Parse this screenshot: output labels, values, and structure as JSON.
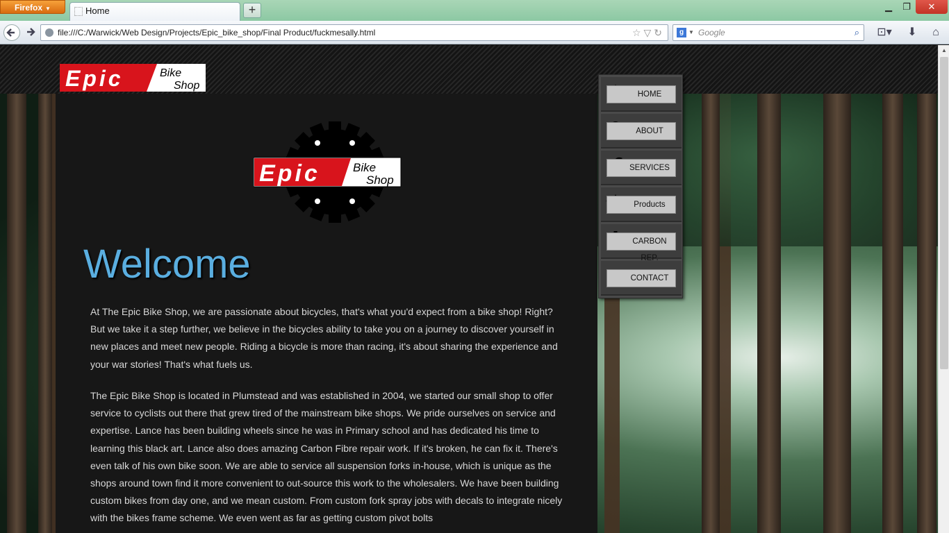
{
  "browser": {
    "app_button": "Firefox",
    "tab_title": "Home",
    "new_tab": "+",
    "url": "file:///C:/Warwick/Web Design/Projects/Epic_bike_shop/Final Product/fuckmesally.html",
    "search_placeholder": "Google"
  },
  "page": {
    "logo_text": "Epic",
    "logo_sub1": "Bike",
    "logo_sub2": "Shop",
    "welcome": "Welcome",
    "paragraphs": [
      "At The Epic Bike Shop, we are passionate about bicycles, that's what you'd expect from a bike shop! Right? But we take it a step further, we believe in the bicycles ability to take you on a journey to discover yourself in new places and meet new people. Riding a bicycle is more than racing, it's about sharing the experience and your war stories! That's what fuels us.",
      "The Epic Bike Shop is located in Plumstead and was established in 2004, we started our small shop to offer service to cyclists out there that grew tired of the mainstream bike shops. We pride ourselves on service and expertise. Lance has been building wheels since he was in Primary school and has dedicated his time to learning this black art. Lance also does amazing Carbon Fibre repair work. If it's broken, he can fix it. There's even talk of his own bike soon. We are able to service all suspension forks in-house, which is unique as the shops around town find it more convenient to out-source this work to the wholesalers. We have been building custom bikes from day one, and we mean custom. From custom fork spray jobs with decals to integrate nicely with the bikes frame scheme. We even went as far as getting custom pivot bolts"
    ],
    "menu": [
      {
        "label": "HOME",
        "icon": "house-icon"
      },
      {
        "label": "ABOUT",
        "icon": "person-icon"
      },
      {
        "label": "SERVICES",
        "icon": "wrench-icon"
      },
      {
        "label": "Products",
        "icon": "basket-icon"
      },
      {
        "label": "CARBON REP.",
        "icon": "gear-icon"
      },
      {
        "label": "CONTACT",
        "icon": "phone-icon"
      }
    ]
  },
  "colors": {
    "welcome": "#5aaee0",
    "logo_red": "#d8141c"
  }
}
